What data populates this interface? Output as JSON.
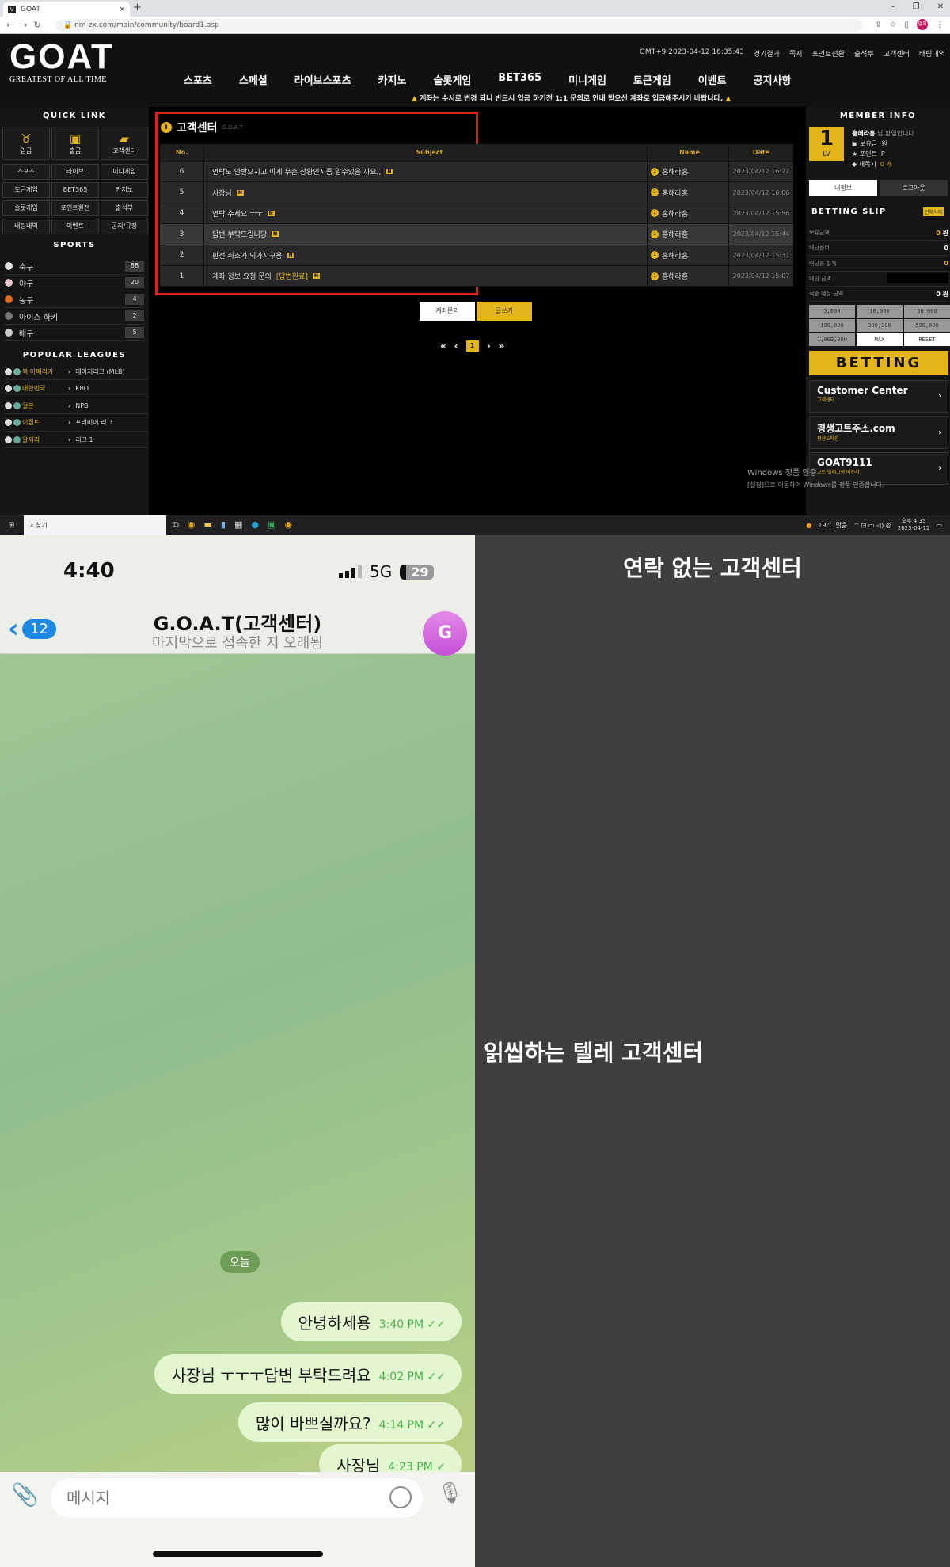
{
  "browser": {
    "tab_title": "GOAT",
    "url": "nm-zx.com/main/community/board1.asp",
    "profile": "망치"
  },
  "header": {
    "logo_text": "GOAT",
    "logo_sub": "GREATEST   OF ALL TIME",
    "clock": "GMT+9 2023-04-12 16:35:43",
    "top_links": [
      "경기결과",
      "쪽지",
      "포인트전환",
      "출석부",
      "고객센터",
      "배팅내역"
    ],
    "nav": [
      "스포츠",
      "스페셜",
      "라이브스포츠",
      "카지노",
      "슬롯게임",
      "BET365",
      "미니게임",
      "토큰게임",
      "이벤트",
      "공지사항"
    ],
    "notice": "계좌는 수시로 변경 되니 반드시 입금 하기전 1:1 문의로 안내 받으신 계좌로 입금해주시기 바랍니다."
  },
  "left": {
    "quick_title": "QUICK LINK",
    "quick_big": [
      {
        "label": "입금",
        "icon": "piggy-bank-icon"
      },
      {
        "label": "출금",
        "icon": "cash-icon"
      },
      {
        "label": "고객센터",
        "icon": "chat-icon"
      }
    ],
    "quick_small": [
      "스포츠",
      "라이브",
      "미니게임",
      "토큰게임",
      "BET365",
      "카지노",
      "슬롯게임",
      "포인트환전",
      "출석부",
      "배팅내역",
      "이벤트",
      "공지/규정"
    ],
    "sports_title": "SPORTS",
    "sports": [
      {
        "name": "축구",
        "count": "88"
      },
      {
        "name": "야구",
        "count": "20"
      },
      {
        "name": "농구",
        "count": "4"
      },
      {
        "name": "아이스 하키",
        "count": "2"
      },
      {
        "name": "배구",
        "count": "5"
      }
    ],
    "leagues_title": "POPULAR LEAGUES",
    "leagues": [
      {
        "country": "북 아메리카",
        "league": "메이저리그 (MLB)"
      },
      {
        "country": "대한민국",
        "league": "KBO"
      },
      {
        "country": "일본",
        "league": "NPB"
      },
      {
        "country": "이집트",
        "league": "프리미어 리그"
      },
      {
        "country": "알제리",
        "league": "리그 1"
      }
    ]
  },
  "board": {
    "title": "고객센터",
    "subtitle": "G.O.A.T",
    "columns": [
      "No.",
      "Subject",
      "Name",
      "Date"
    ],
    "rows": [
      {
        "no": "6",
        "subject": "연락도 안받으시고 이게 무슨 상황인지좀 알수있을 까요,,",
        "tag": "",
        "name": "홍해라홍",
        "date": "2023/04/12 16:27"
      },
      {
        "no": "5",
        "subject": "사장님",
        "tag": "",
        "name": "홍해라홍",
        "date": "2023/04/12 16:06"
      },
      {
        "no": "4",
        "subject": "연락 주세요 ㅜㅜ",
        "tag": "",
        "name": "홍해라홍",
        "date": "2023/04/12 15:56"
      },
      {
        "no": "3",
        "subject": "답변 부탁드립니당",
        "tag": "",
        "name": "홍해라홍",
        "date": "2023/04/12 15:44"
      },
      {
        "no": "2",
        "subject": "환전 취소가 되가지구용",
        "tag": "",
        "name": "홍해라홍",
        "date": "2023/04/12 15:31"
      },
      {
        "no": "1",
        "subject": "계좌 정보 요청 문의",
        "tag": "[답변완료]",
        "name": "홍해라홍",
        "date": "2023/04/12 15:07"
      }
    ],
    "new_badge": "N",
    "level_badge": "1",
    "btn_account": "계좌문의",
    "btn_write": "글쓰기",
    "pager": {
      "first": "«",
      "prev": "‹",
      "current": "1",
      "next": "›",
      "last": "»"
    }
  },
  "watermark": {
    "title": "Windows 정품 인증",
    "sub": "[설정]으로 이동하여 Windows를 정품 인증합니다."
  },
  "member": {
    "title": "MEMBER INFO",
    "level": "1",
    "level_label": "LV",
    "name": "홍해라홍",
    "greet": "님 환영합니다",
    "money_label": "보유금",
    "money_unit": "원",
    "point_label": "포인트",
    "point_unit": "P",
    "msg_label": "새쪽지",
    "msg_val": "0 개",
    "btn_info": "내정보",
    "btn_logout": "로그아웃"
  },
  "slip": {
    "title": "BETTING SLIP",
    "clear": "전체삭제",
    "rows": [
      {
        "label": "보유금액",
        "value": "0",
        "unit": " 원"
      },
      {
        "label": "배당폴더",
        "value": "0",
        "unit": ""
      },
      {
        "label": "배당률 합계",
        "value": "0",
        "unit": ""
      },
      {
        "label": "배팅 금액",
        "value": "",
        "unit": ""
      },
      {
        "label": "적중 예상 금액",
        "value": "0",
        "unit": " 원"
      }
    ],
    "amounts": [
      "5,000",
      "10,000",
      "50,000",
      "100,000",
      "300,000",
      "500,000",
      "1,000,000",
      "MAX",
      "RESET"
    ],
    "bet": "BETTING"
  },
  "cards": [
    {
      "title": "Customer Center",
      "sub": "고객센터"
    },
    {
      "title": "평생고트주소.com",
      "sub": "평생도메인"
    },
    {
      "title": "GOAT9111",
      "sub": "고트 텔레그램 메신저"
    }
  ],
  "taskbar": {
    "search": "찾기",
    "weather": "19°C 맑음",
    "time": "오후 4:35",
    "date": "2023-04-12"
  },
  "phone": {
    "time": "4:40",
    "network": "5G",
    "battery": "29",
    "back_count": "12",
    "chat_title": "G.O.A.T(고객센터)",
    "chat_sub": "마지막으로 접속한 지 오래됨",
    "avatar": "G",
    "day": "오늘",
    "messages": [
      {
        "text": "안녕하세용",
        "time": "3:40 PM",
        "read": true
      },
      {
        "text": "사장님 ㅜㅜㅜ답변 부탁드려요",
        "time": "4:02 PM",
        "read": true
      },
      {
        "text": "많이 바쁘실까요?",
        "time": "4:14 PM",
        "read": true
      },
      {
        "text": "사장님",
        "time": "4:23 PM",
        "read": false
      }
    ],
    "input_placeholder": "메시지"
  },
  "captions": {
    "top": "연락 없는 고객센터",
    "middle": "읽씹하는 텔레 고객센터"
  },
  "colors": {
    "accent": "#e3b51b",
    "highlight_box": "#e02020",
    "bubble": "#e2f7cf",
    "telegram_blue": "#1e88e5"
  }
}
